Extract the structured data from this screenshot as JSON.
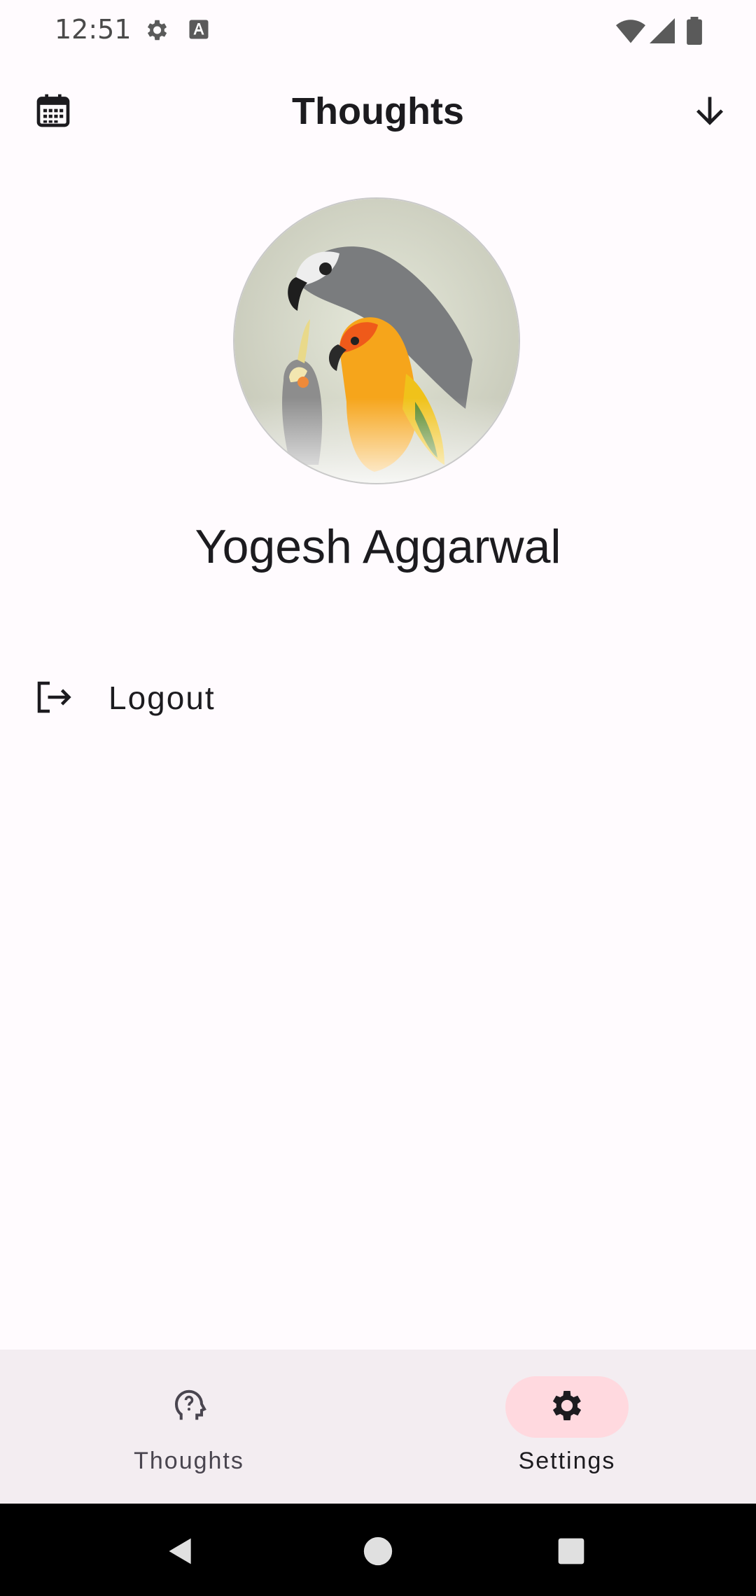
{
  "status_bar": {
    "time": "12:51",
    "icons": [
      "settings-icon",
      "keyboard-a-icon",
      "wifi-icon",
      "cellular-icon",
      "battery-icon"
    ]
  },
  "app_bar": {
    "title": "Thoughts",
    "left_icon": "calendar-icon",
    "right_icon": "arrow-down-icon"
  },
  "profile": {
    "avatar": "parrots-avatar",
    "name": "Yogesh Aggarwal"
  },
  "menu": [
    {
      "icon": "logout-icon",
      "label": "Logout"
    }
  ],
  "bottom_nav": {
    "items": [
      {
        "label": "Thoughts",
        "icon": "head-question-icon",
        "active": false
      },
      {
        "label": "Settings",
        "icon": "gear-icon",
        "active": true
      }
    ],
    "active_color": "#ffd9df"
  },
  "colors": {
    "background": "#fffbfe",
    "nav_background": "#f3edf1",
    "system_nav": "#000000"
  }
}
